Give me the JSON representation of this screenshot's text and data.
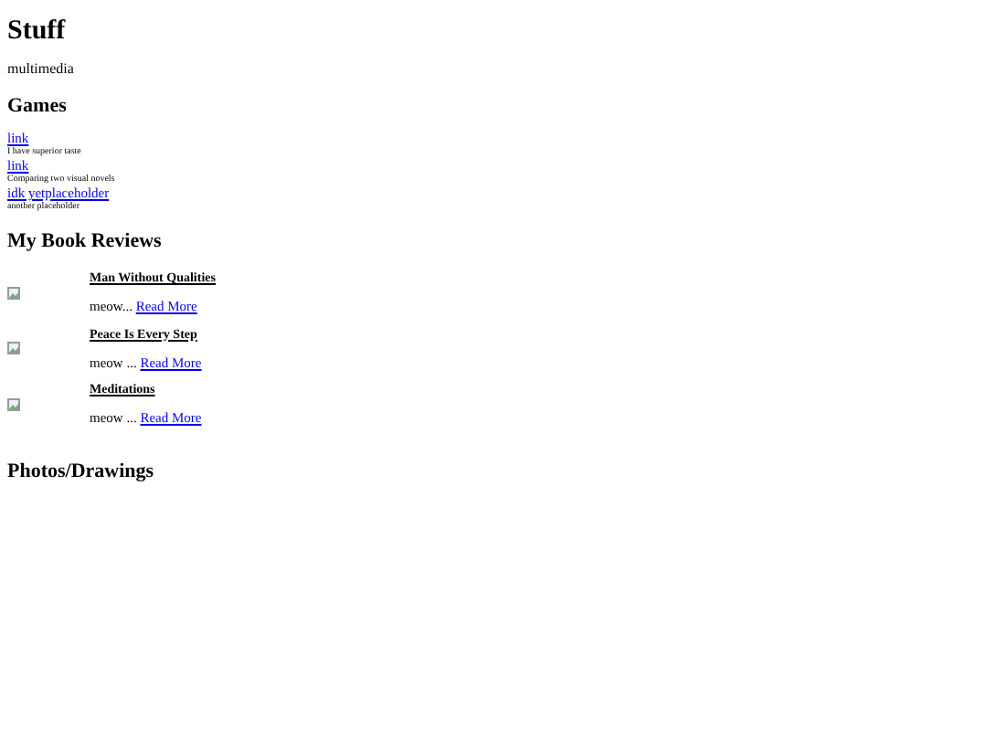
{
  "title": "Stuff",
  "subtitle": "multimedia",
  "games": {
    "heading": "Games",
    "items": [
      {
        "link": "link",
        "note": "I have superior taste"
      },
      {
        "link": "link",
        "note": "Comparing two visual novels"
      },
      {
        "link": "idk yetplaceholder",
        "note": "another placeholder"
      }
    ]
  },
  "reviews": {
    "heading": "My Book Reviews",
    "items": [
      {
        "title": "Man Without Qualities",
        "excerpt": "meow...",
        "more": "Read More"
      },
      {
        "title": "Peace Is Every Step",
        "excerpt": "meow ...",
        "more": "Read More"
      },
      {
        "title": "Meditations",
        "excerpt": "meow ...",
        "more": "Read More"
      }
    ]
  },
  "photos": {
    "heading": "Photos/Drawings"
  }
}
